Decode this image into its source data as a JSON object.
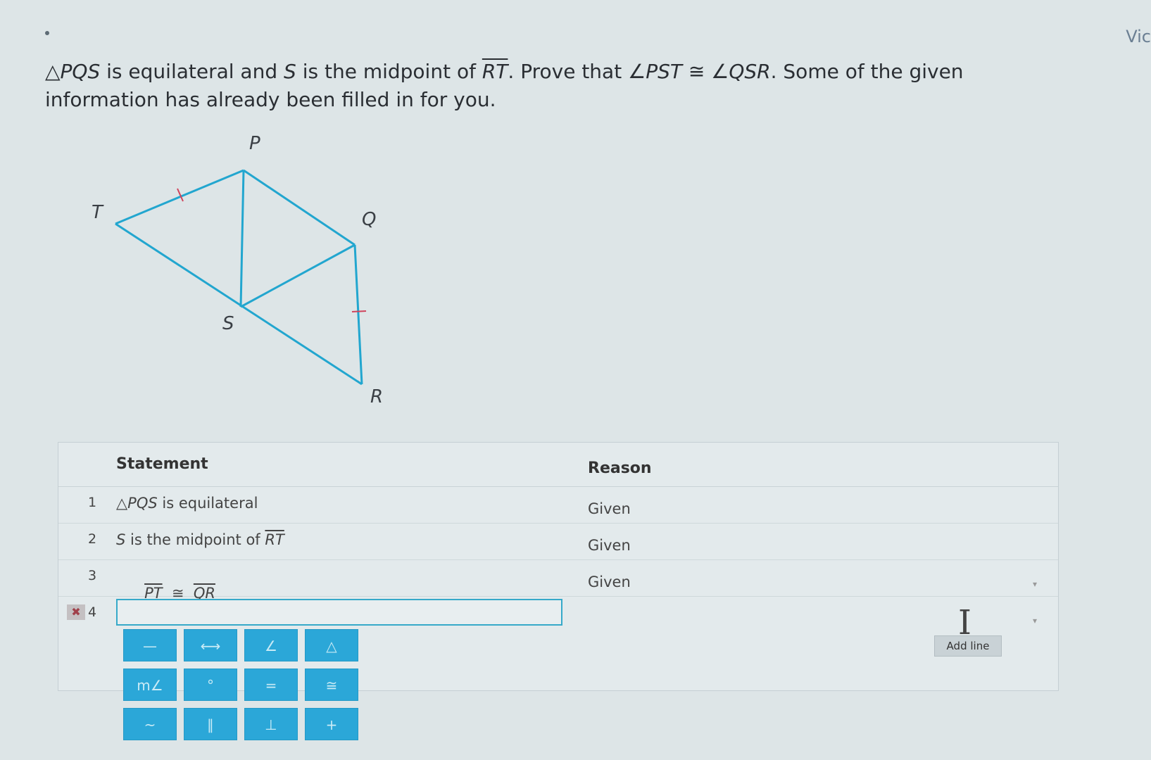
{
  "header": {
    "top_right_link": "Vic"
  },
  "problem": {
    "part1": "△",
    "part2": "PQS",
    "part3": " is equilateral and ",
    "part4": "S",
    "part5": " is the midpoint of ",
    "part6": "RT",
    "part7": ". Prove that ∠",
    "part8": "PST",
    "part9": " ≅ ∠",
    "part10": "QSR",
    "part11": ". Some of the given information has already been filled in for you."
  },
  "diagram": {
    "labels": {
      "P": "P",
      "Q": "Q",
      "R": "R",
      "S": "S",
      "T": "T"
    },
    "line_color": "#22a6cf",
    "tick_color": "#d0445c"
  },
  "proof": {
    "header_statement": "Statement",
    "header_reason": "Reason",
    "rows": [
      {
        "num": "1",
        "stmt_a": "△",
        "stmt_b": "PQS",
        "stmt_c": " is equilateral",
        "reason": "Given"
      },
      {
        "num": "2",
        "stmt_a": "S",
        "stmt_b": " is the midpoint of ",
        "stmt_c": "RT",
        "reason": "Given"
      },
      {
        "num": "3",
        "stmt_a": "PT",
        "stmt_b": "  ≅  ",
        "stmt_c": "QR",
        "reason": "Given"
      },
      {
        "num": "4",
        "stmt_value": "",
        "reason": ""
      }
    ],
    "delete_icon": "✖",
    "reason_caret": "▾",
    "add_line_label": "Add line"
  },
  "palette": {
    "row1": [
      "—",
      "⟷",
      "∠",
      "△"
    ],
    "row2": [
      "m∠",
      "°",
      "=",
      "≅"
    ],
    "row3": [
      "~",
      "∥",
      "⊥",
      "+"
    ]
  },
  "colors": {
    "accent": "#2ba7d8",
    "background": "#dde5e7"
  }
}
